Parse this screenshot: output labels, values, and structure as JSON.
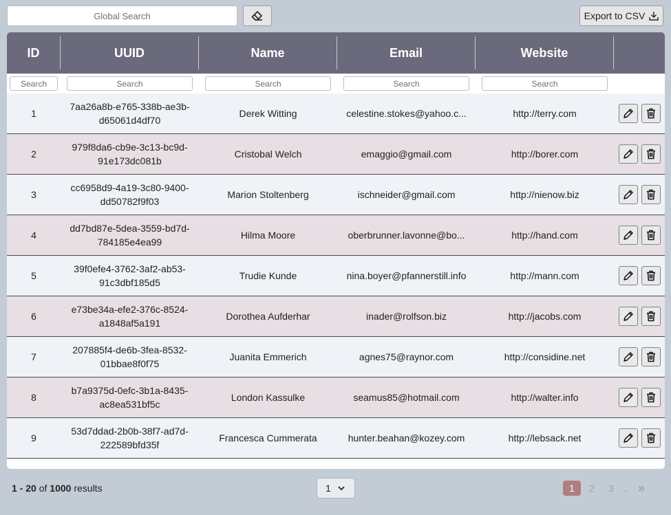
{
  "toolbar": {
    "global_search_placeholder": "Global Search",
    "export_label": "Export to CSV"
  },
  "table": {
    "columns": [
      {
        "key": "id",
        "label": "ID",
        "filter_placeholder": "Search"
      },
      {
        "key": "uuid",
        "label": "UUID",
        "filter_placeholder": "Search"
      },
      {
        "key": "name",
        "label": "Name",
        "filter_placeholder": "Search"
      },
      {
        "key": "email",
        "label": "Email",
        "filter_placeholder": "Search"
      },
      {
        "key": "website",
        "label": "Website",
        "filter_placeholder": "Search"
      },
      {
        "key": "actions",
        "label": "",
        "filter_placeholder": ""
      }
    ],
    "rows": [
      {
        "id": "1",
        "uuid": "7aa26a8b-e765-338b-ae3b-d65061d4df70",
        "name": "Derek Witting",
        "email": "celestine.stokes@yahoo.c...",
        "website": "http://terry.com"
      },
      {
        "id": "2",
        "uuid": "979f8da6-cb9e-3c13-bc9d-91e173dc081b",
        "name": "Cristobal Welch",
        "email": "emaggio@gmail.com",
        "website": "http://borer.com"
      },
      {
        "id": "3",
        "uuid": "cc6958d9-4a19-3c80-9400-dd50782f9f03",
        "name": "Marion Stoltenberg",
        "email": "ischneider@gmail.com",
        "website": "http://nienow.biz"
      },
      {
        "id": "4",
        "uuid": "dd7bd87e-5dea-3559-bd7d-784185e4ea99",
        "name": "Hilma Moore",
        "email": "oberbrunner.lavonne@bo...",
        "website": "http://hand.com"
      },
      {
        "id": "5",
        "uuid": "39f0efe4-3762-3af2-ab53-91c3dbf185d5",
        "name": "Trudie Kunde",
        "email": "nina.boyer@pfannerstill.info",
        "website": "http://mann.com"
      },
      {
        "id": "6",
        "uuid": "e73be34a-efe2-376c-8524-a1848af5a191",
        "name": "Dorothea Aufderhar",
        "email": "inader@rolfson.biz",
        "website": "http://jacobs.com"
      },
      {
        "id": "7",
        "uuid": "207885f4-de6b-3fea-8532-01bbae8f0f75",
        "name": "Juanita Emmerich",
        "email": "agnes75@raynor.com",
        "website": "http://considine.net"
      },
      {
        "id": "8",
        "uuid": "b7a9375d-0efc-3b1a-8435-ac8ea531bf5c",
        "name": "London Kassulke",
        "email": "seamus85@hotmail.com",
        "website": "http://walter.info"
      },
      {
        "id": "9",
        "uuid": "53d7ddad-2b0b-38f7-ad7d-222589bfd35f",
        "name": "Francesca Cummerata",
        "email": "hunter.beahan@kozey.com",
        "website": "http://lebsack.net"
      }
    ]
  },
  "footer": {
    "range": "1 - 20",
    "of_text": "of",
    "total": "1000",
    "results_text": "results",
    "page_select_value": "1",
    "pages": [
      "1",
      "2",
      "3"
    ],
    "active_page": "1",
    "ellipsis": "..",
    "next_label": "»",
    "prev_label": "«"
  },
  "icons": {
    "clear": "eraser-icon",
    "export": "download-icon",
    "edit": "pencil-icon",
    "delete": "trash-icon"
  },
  "colors": {
    "header_bg": "#6b6a7c",
    "row_odd": "#eff2f6",
    "row_even": "#e7dfe3",
    "active_page": "#b07d82"
  }
}
